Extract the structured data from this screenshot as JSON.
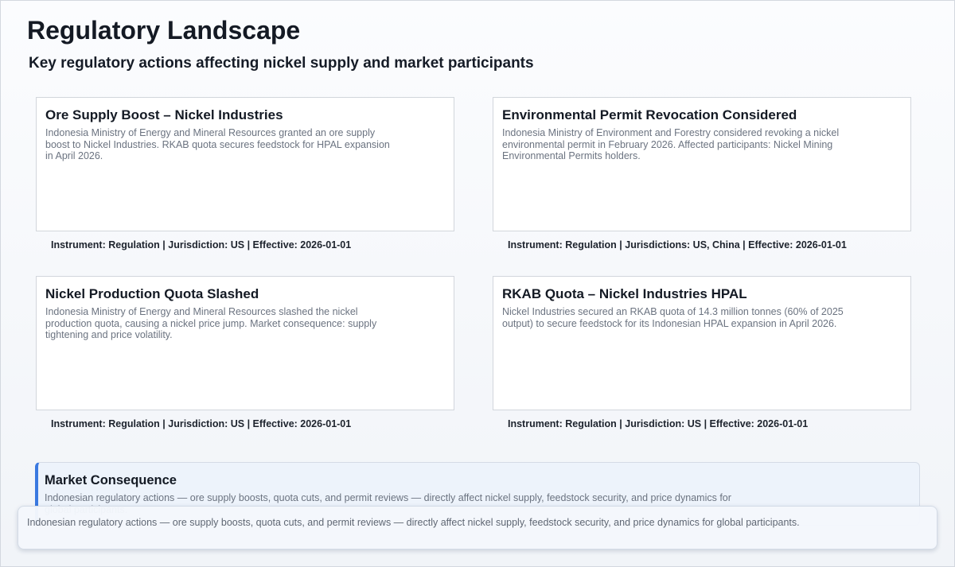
{
  "header": {
    "title": "Regulatory Landscape",
    "subtitle": "Key regulatory actions affecting nickel supply and market participants"
  },
  "cards": [
    {
      "title": "Ore Supply Boost – Nickel Industries",
      "description": "Indonesia Ministry of Energy and Mineral Resources granted an ore supply boost to Nickel Industries. RKAB quota secures feedstock for HPAL expansion in April 2026.",
      "meta": "Instrument: Regulation | Jurisdiction: US | Effective: 2026-01-01"
    },
    {
      "title": "Environmental Permit Revocation Considered",
      "description": "Indonesia Ministry of Environment and Forestry considered revoking a nickel environmental permit in February 2026. Affected participants: Nickel Mining Environmental Permits holders.",
      "meta": "Instrument: Regulation | Jurisdictions: US, China | Effective: 2026-01-01"
    },
    {
      "title": "Nickel Production Quota Slashed",
      "description": "Indonesia Ministry of Energy and Mineral Resources slashed the nickel production quota, causing a nickel price jump. Market consequence: supply tightening and price volatility.",
      "meta": "Instrument: Regulation | Jurisdiction: US | Effective: 2026-01-01"
    },
    {
      "title": "RKAB Quota – Nickel Industries HPAL",
      "description": "Nickel Industries secured an RKAB quota of 14.3 million tonnes (60% of 2025 output) to secure feedstock for its Indonesian HPAL expansion in April 2026.",
      "meta": "Instrument: Regulation | Jurisdiction: US | Effective: 2026-01-01"
    }
  ],
  "consequence": {
    "title": "Market Consequence",
    "body": "Indonesian regulatory actions — ore supply boosts, quota cuts, and permit reviews — directly affect nickel supply, feedstock security, and price dynamics for global participants."
  },
  "tooltip": {
    "text": "Indonesian regulatory actions — ore supply boosts, quota cuts, and permit reviews — directly affect nickel supply, feedstock security, and price dynamics for global participants."
  }
}
